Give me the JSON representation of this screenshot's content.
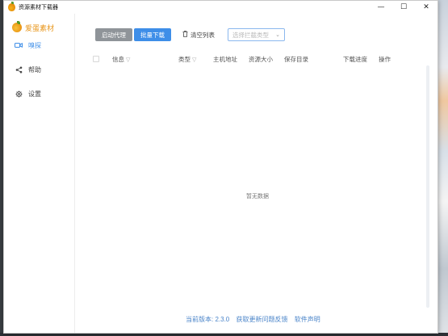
{
  "window": {
    "title": "资源素材下载器",
    "controls": {
      "minimize": "—",
      "maximize": "☐",
      "close": "✕"
    }
  },
  "sidebar": {
    "brand": "爱蛋素材",
    "items": [
      {
        "label": "嗅探",
        "icon": "video-camera-icon",
        "active": true
      },
      {
        "label": "帮助",
        "icon": "share-icon",
        "active": false
      },
      {
        "label": "设置",
        "icon": "gear-icon",
        "active": false
      }
    ]
  },
  "toolbar": {
    "start_proxy": "启动代理",
    "batch_download": "批量下载",
    "clear_list": "清空列表",
    "resource_type_placeholder": "选择拦截类型"
  },
  "table": {
    "columns": [
      "信息",
      "类型",
      "主机地址",
      "资源大小",
      "保存目录",
      "下载进度",
      "操作"
    ]
  },
  "empty_text": "暂无数据",
  "footer": {
    "version": "当前版本: 2.3.0",
    "latest": "获取更新",
    "feedback": "问题反馈",
    "notice": "软件声明"
  },
  "colors": {
    "accent": "#3e8ee8",
    "brand": "#e8961b",
    "gray_button": "#8f9499"
  }
}
